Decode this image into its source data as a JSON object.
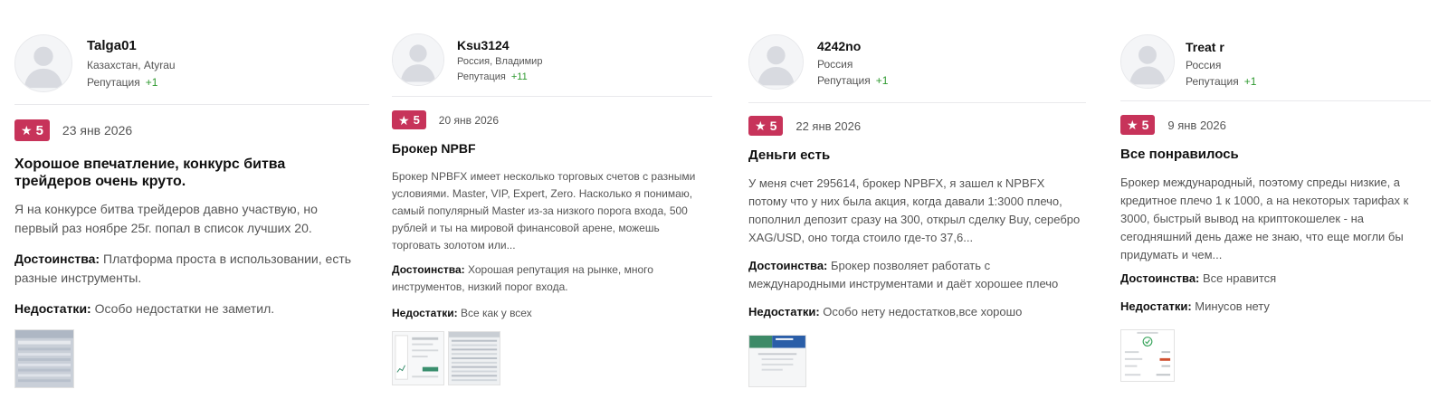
{
  "reviews": [
    {
      "user": {
        "name": "Talga01",
        "location": "Казахстан, Atyrau",
        "reputation_label": "Репутация",
        "reputation_value": "+1"
      },
      "rating": "5",
      "date": "23 янв 2026",
      "title": "Хорошое впечатление, конкурс битва трейдеров очень круто.",
      "text": "Я на конкурсе битва трейдеров давно участвую, но первый раз ноябре 25г. попал в список лучших 20.",
      "pros_label": "Достоинства:",
      "pros": "Платформа проста в использовании, есть разные инструменты.",
      "cons_label": "Недостатки:",
      "cons": "Особо недостатки не заметил.",
      "star_icon": "star-icon",
      "avatar_icon": "avatar-placeholder-icon"
    },
    {
      "user": {
        "name": "Ksu3124",
        "location": "Россия, Владимир",
        "reputation_label": "Репутация",
        "reputation_value": "+11"
      },
      "rating": "5",
      "date": "20 янв 2026",
      "title": "Брокер NPBF",
      "text": "Брокер NPBFX имеет несколько торговых счетов с разными условиями. Master, VIP, Expert, Zero. Насколько я понимаю, самый популярный Master из-за низкого порога входа, 500 рублей и ты на мировой финансовой арене, можешь торговать золотом или...",
      "pros_label": "Достоинства:",
      "pros": "Хорошая репутация на рынке, много инструментов, низкий порог входа.",
      "cons_label": "Недостатки:",
      "cons": "Все как у всех",
      "star_icon": "star-icon",
      "avatar_icon": "avatar-placeholder-icon"
    },
    {
      "user": {
        "name": "4242no",
        "location": "Россия",
        "reputation_label": "Репутация",
        "reputation_value": "+1"
      },
      "rating": "5",
      "date": "22 янв 2026",
      "title": "Деньги есть",
      "text": "У меня счет 295614, брокер NPBFX, я зашел к NPBFX потому что у них была акция, когда давали 1:3000 плечо, пополнил депозит сразу на 300, открыл сделку Buy, серебро XAG/USD, оно тогда стоило где-то 37,6...",
      "pros_label": "Достоинства:",
      "pros": "Брокер позволяет работать с международными инструментами и даёт хорошее плечо",
      "cons_label": "Недостатки:",
      "cons": "Особо нету недостатков,все хорошо",
      "star_icon": "star-icon",
      "avatar_icon": "avatar-placeholder-icon"
    },
    {
      "user": {
        "name": "Treat r",
        "location": "Россия",
        "reputation_label": "Репутация",
        "reputation_value": "+1"
      },
      "rating": "5",
      "date": "9 янв 2026",
      "title": "Все понравилось",
      "text": "Брокер международный, поэтому спреды низкие, а кредитное плечо 1 к 1000, а на некоторых тарифах к 3000, быстрый вывод на криптокошелек - на сегодняшний день даже не знаю, что еще могли бы придумать и чем...",
      "pros_label": "Достоинства:",
      "pros": "Все нравится",
      "cons_label": "Недостатки:",
      "cons": "Минусов нету",
      "star_icon": "star-icon",
      "avatar_icon": "avatar-placeholder-icon"
    }
  ],
  "colors": {
    "badge": "#c7335a",
    "reputation_plus": "#2f9a30",
    "title": "#111111",
    "body_text": "#555555",
    "divider": "#e9e9ec"
  }
}
